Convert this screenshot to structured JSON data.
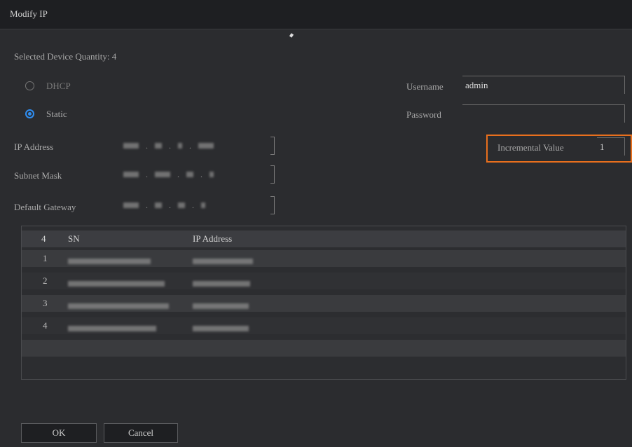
{
  "dialog": {
    "title": "Modify IP"
  },
  "selected": {
    "text": "Selected Device Quantity: 4"
  },
  "mode": {
    "dhcp_label": "DHCP",
    "static_label": "Static",
    "selected": "Static"
  },
  "network": {
    "ip_label": "IP Address",
    "subnet_label": "Subnet Mask",
    "gateway_label": "Default Gateway"
  },
  "auth": {
    "username_label": "Username",
    "username_value": "admin",
    "password_label": "Password",
    "password_value": ""
  },
  "increment": {
    "label": "Incremental Value",
    "value": "1",
    "highlight_color": "#e86f1d"
  },
  "table": {
    "headers": {
      "count": "4",
      "sn": "SN",
      "ip": "IP Address"
    },
    "rows": [
      {
        "index": "1"
      },
      {
        "index": "2"
      },
      {
        "index": "3"
      },
      {
        "index": "4"
      }
    ]
  },
  "buttons": {
    "ok": "OK",
    "cancel": "Cancel"
  },
  "colors": {
    "accent": "#2f8ef2",
    "background": "#2b2c2f",
    "titlebar": "#1e1f22"
  }
}
